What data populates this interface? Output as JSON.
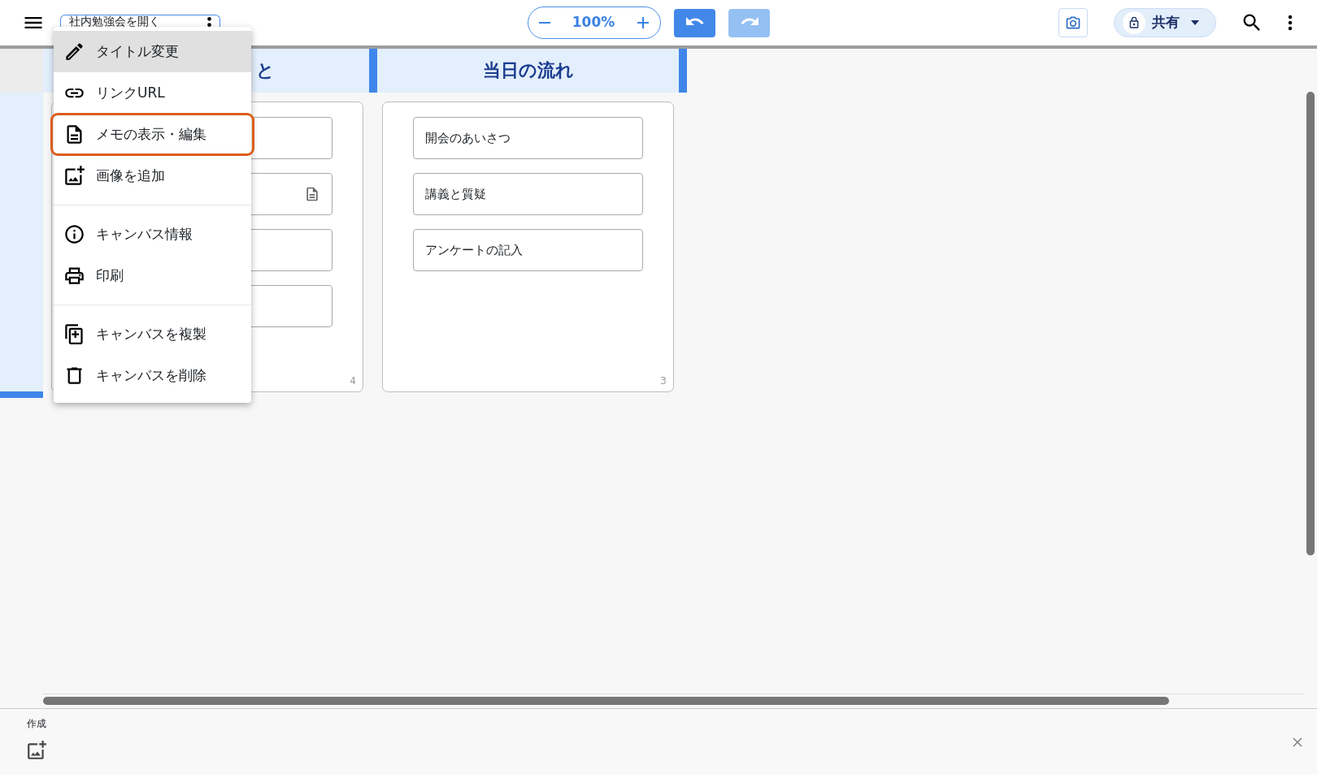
{
  "app_bar": {
    "title_field": "社内勉強会を開く",
    "zoom": "100%",
    "undo": {
      "disabled": false
    },
    "redo": {
      "disabled": true
    },
    "share": "共有"
  },
  "menu": {
    "groups": [
      [
        {
          "kind": "pencil",
          "label": "タイトル変更",
          "highlighted": true,
          "focused": false
        },
        {
          "kind": "link",
          "label": "リンクURL",
          "highlighted": false,
          "focused": false
        },
        {
          "kind": "memo",
          "label": "メモの表示・編集",
          "highlighted": false,
          "focused": true
        },
        {
          "kind": "image-add",
          "label": "画像を追加",
          "highlighted": false,
          "focused": false
        }
      ],
      [
        {
          "kind": "info",
          "label": "キャンバス情報",
          "highlighted": false,
          "focused": false
        },
        {
          "kind": "print",
          "label": "印刷",
          "highlighted": false,
          "focused": false
        }
      ],
      [
        {
          "kind": "copy",
          "label": "キャンバスを複製",
          "highlighted": false,
          "focused": false
        },
        {
          "kind": "trash",
          "label": "キャンバスを削除",
          "highlighted": false,
          "focused": false
        }
      ]
    ]
  },
  "columns": [
    {
      "title": "と",
      "count": "4",
      "cards": [
        {
          "memo": false
        },
        {
          "memo": true
        },
        {
          "memo": false
        },
        {
          "memo": false
        }
      ]
    },
    {
      "title": "当日の流れ",
      "count": "3",
      "cards": [
        {
          "text": "開会のあいさつ",
          "memo": false
        },
        {
          "text": "講義と質疑",
          "memo": false
        },
        {
          "text": "アンケートの記入",
          "memo": false
        }
      ]
    }
  ],
  "bottom_panel": {
    "label": "作成"
  }
}
